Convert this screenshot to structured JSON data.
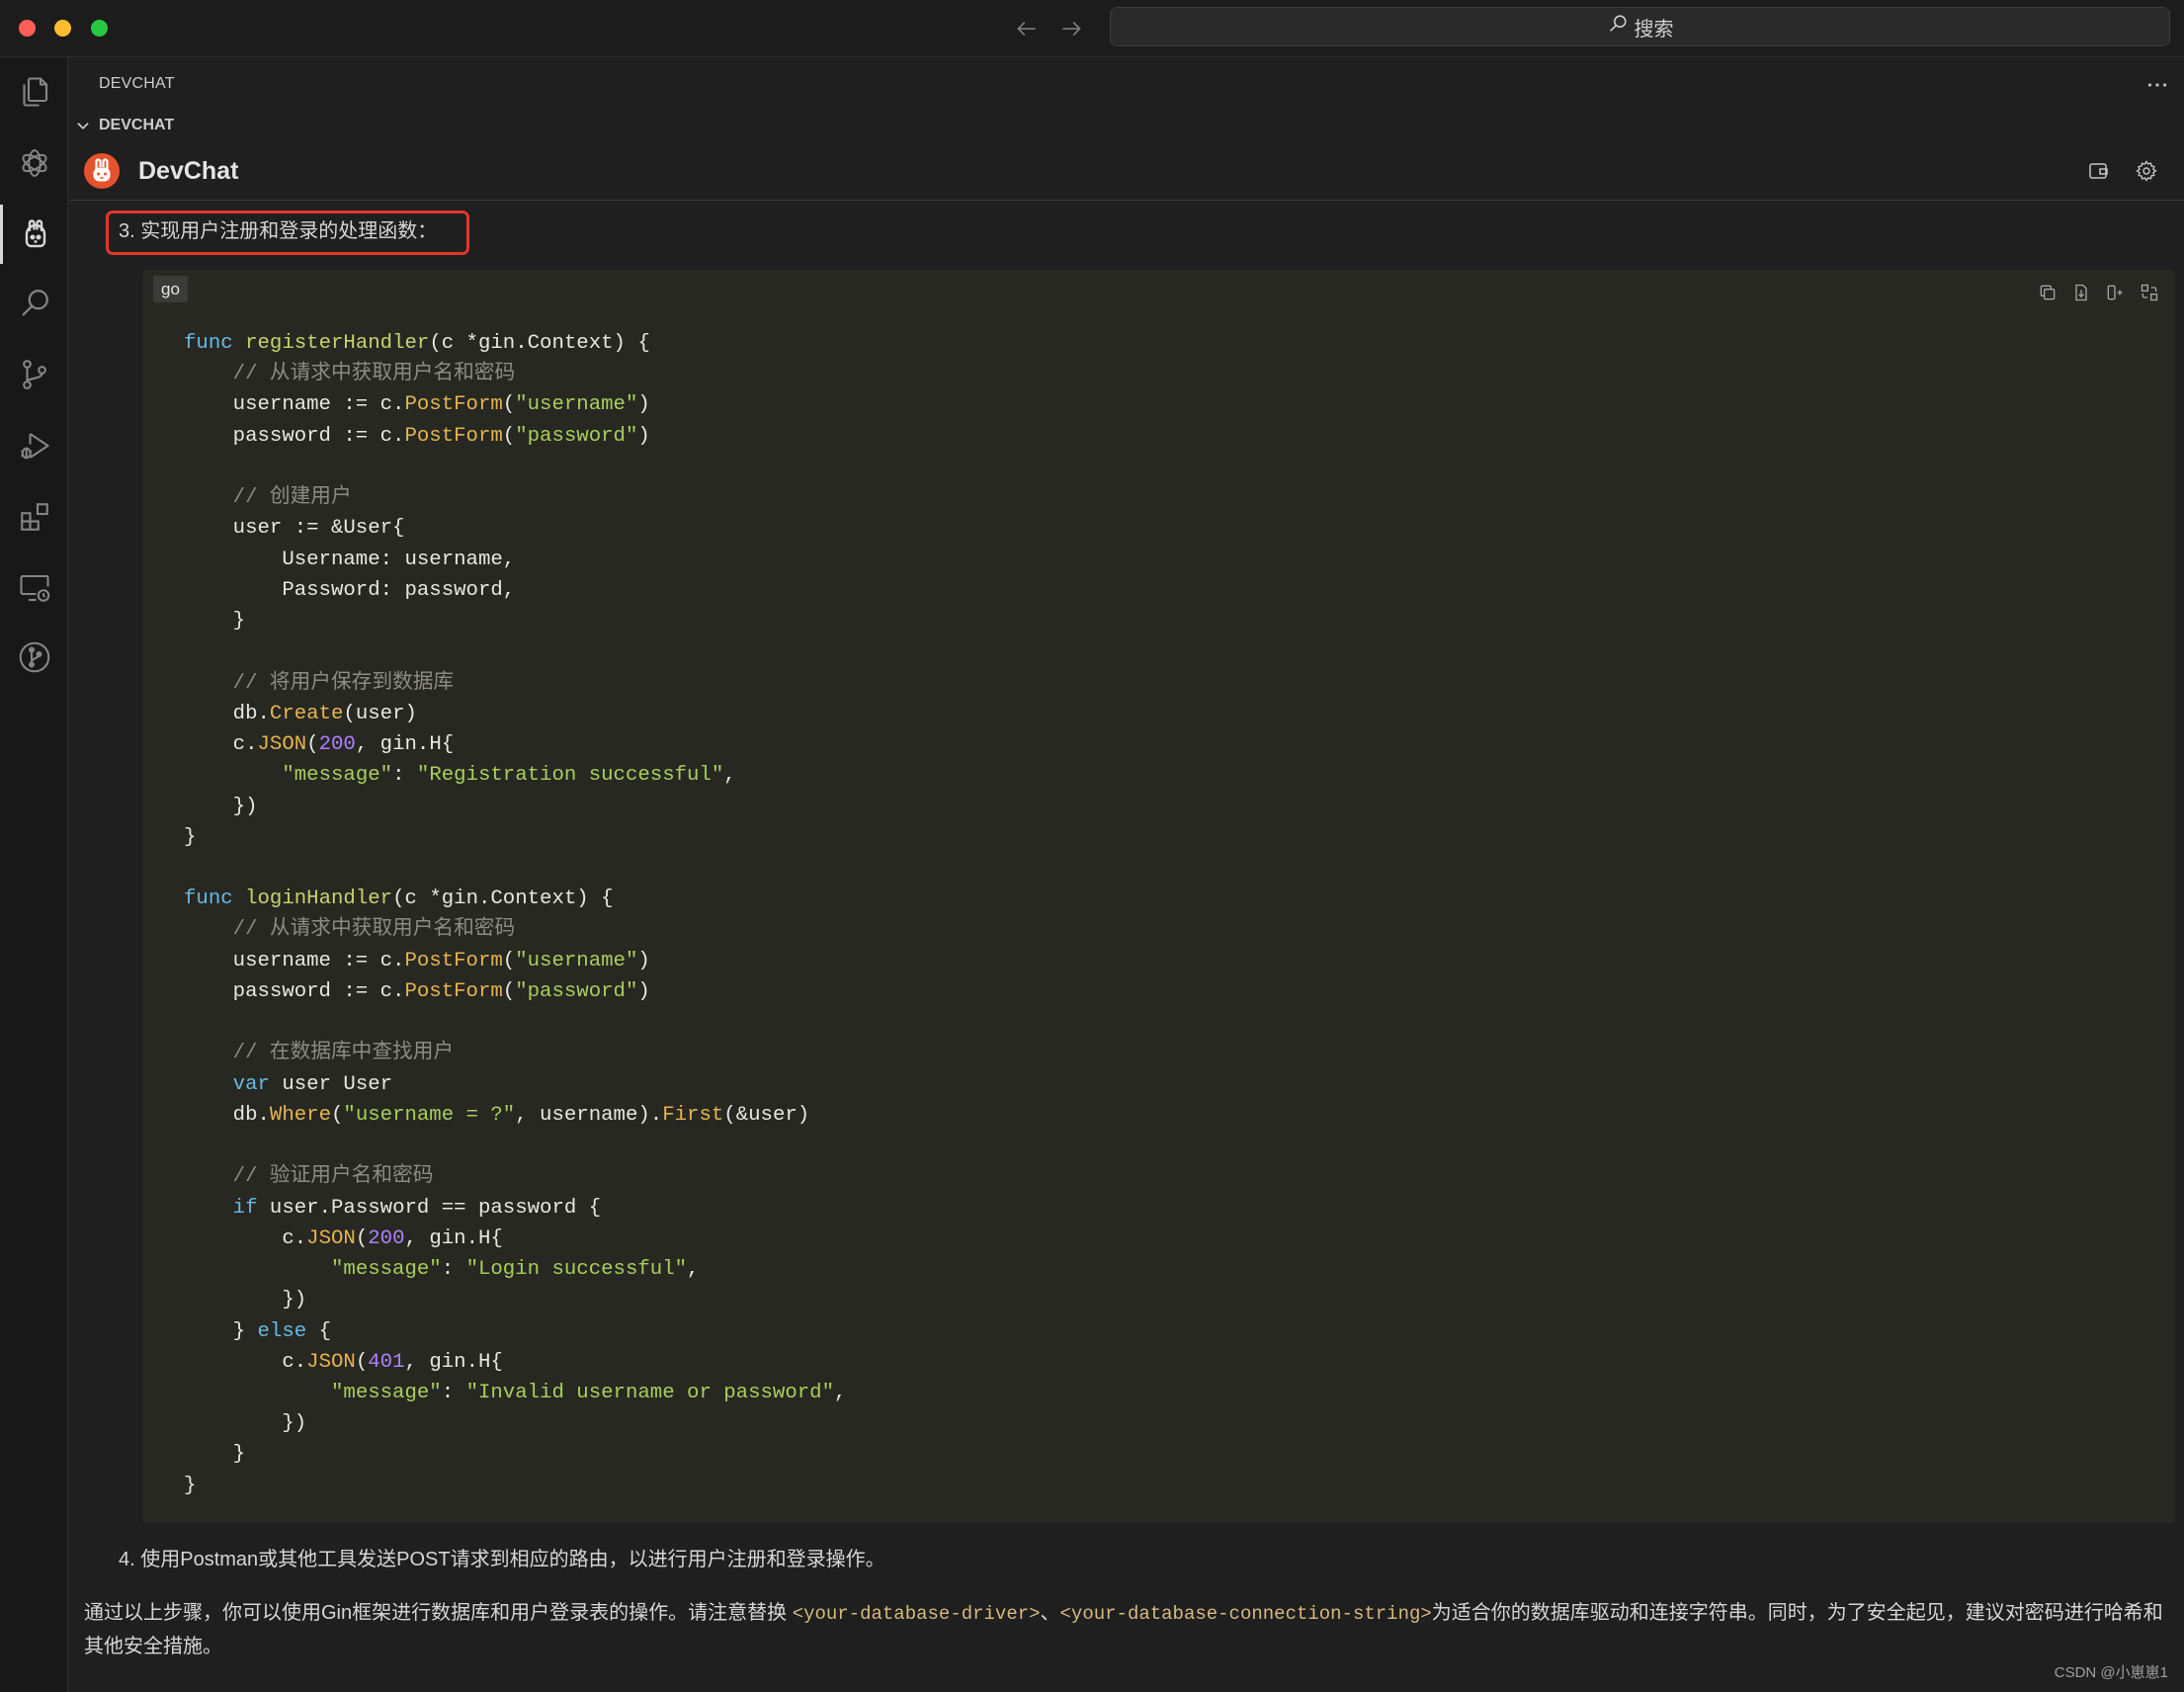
{
  "window": {
    "traffic_lights": {
      "close": "#ff5f57",
      "minimize": "#febc2e",
      "zoom": "#28c840"
    },
    "nav": {
      "back_icon": "arrow-left-icon",
      "forward_icon": "arrow-right-icon"
    },
    "search": {
      "label": "搜索",
      "icon": "search-icon"
    }
  },
  "activity_bar": {
    "items": [
      {
        "icon": "files-icon",
        "active": false
      },
      {
        "icon": "openai-icon",
        "active": false
      },
      {
        "icon": "devchat-rabbit-icon",
        "active": true
      },
      {
        "icon": "search-icon",
        "active": false
      },
      {
        "icon": "source-control-icon",
        "active": false
      },
      {
        "icon": "run-debug-icon",
        "active": false
      },
      {
        "icon": "extensions-icon",
        "active": false
      },
      {
        "icon": "remote-explorer-icon",
        "active": false
      },
      {
        "icon": "git-graph-icon",
        "active": false
      }
    ]
  },
  "panel": {
    "title": "DEVCHAT",
    "more_icon": "ellipsis-icon",
    "section": {
      "title": "DEVCHAT",
      "expanded": true
    },
    "header": {
      "name": "DevChat",
      "logo": "devchat-logo",
      "actions": [
        "new-chat-icon",
        "settings-icon"
      ]
    }
  },
  "chat": {
    "step3": "3. 实现用户注册和登录的处理函数：",
    "highlight_color": "#e0372c",
    "code_block": {
      "language": "go",
      "background": "#272822",
      "actions": [
        "copy-icon",
        "insert-file-icon",
        "insert-code-icon",
        "diff-icon"
      ],
      "lines": [
        [
          {
            "text": "func",
            "color": "#66b9e4"
          },
          " ",
          {
            "text": "registerHandler",
            "color": "#c6d36c"
          },
          "(c *gin.Context) {"
        ],
        [
          "    ",
          {
            "text": "// 从请求中获取用户名和密码",
            "color": "#8c8c84"
          }
        ],
        [
          "    username := c.",
          {
            "text": "PostForm",
            "color": "#e6b450"
          },
          "(",
          {
            "text": "\"username\"",
            "color": "#a8cf5a"
          },
          ")"
        ],
        [
          "    password := c.",
          {
            "text": "PostForm",
            "color": "#e6b450"
          },
          "(",
          {
            "text": "\"password\"",
            "color": "#a8cf5a"
          },
          ")"
        ],
        [],
        [
          "    ",
          {
            "text": "// 创建用户",
            "color": "#8c8c84"
          }
        ],
        [
          "    user := &User{"
        ],
        [
          "        Username: username,"
        ],
        [
          "        Password: password,"
        ],
        [
          "    }"
        ],
        [],
        [
          "    ",
          {
            "text": "// 将用户保存到数据库",
            "color": "#8c8c84"
          }
        ],
        [
          "    db.",
          {
            "text": "Create",
            "color": "#e6b450"
          },
          "(user)"
        ],
        [
          "    c.",
          {
            "text": "JSON",
            "color": "#e6b450"
          },
          "(",
          {
            "text": "200",
            "color": "#ae81ff"
          },
          ", gin.H{"
        ],
        [
          "        ",
          {
            "text": "\"message\"",
            "color": "#a8cf5a"
          },
          ": ",
          {
            "text": "\"Registration successful\"",
            "color": "#a8cf5a"
          },
          ","
        ],
        [
          "    })"
        ],
        [
          "}"
        ],
        [],
        [
          {
            "text": "func",
            "color": "#66b9e4"
          },
          " ",
          {
            "text": "loginHandler",
            "color": "#c6d36c"
          },
          "(c *gin.Context) {"
        ],
        [
          "    ",
          {
            "text": "// 从请求中获取用户名和密码",
            "color": "#8c8c84"
          }
        ],
        [
          "    username := c.",
          {
            "text": "PostForm",
            "color": "#e6b450"
          },
          "(",
          {
            "text": "\"username\"",
            "color": "#a8cf5a"
          },
          ")"
        ],
        [
          "    password := c.",
          {
            "text": "PostForm",
            "color": "#e6b450"
          },
          "(",
          {
            "text": "\"password\"",
            "color": "#a8cf5a"
          },
          ")"
        ],
        [],
        [
          "    ",
          {
            "text": "// 在数据库中查找用户",
            "color": "#8c8c84"
          }
        ],
        [
          "    ",
          {
            "text": "var",
            "color": "#66b9e4"
          },
          " user User"
        ],
        [
          "    db.",
          {
            "text": "Where",
            "color": "#e6b450"
          },
          "(",
          {
            "text": "\"username = ?\"",
            "color": "#a8cf5a"
          },
          ", username).",
          {
            "text": "First",
            "color": "#e6b450"
          },
          "(&user)"
        ],
        [],
        [
          "    ",
          {
            "text": "// 验证用户名和密码",
            "color": "#8c8c84"
          }
        ],
        [
          "    ",
          {
            "text": "if",
            "color": "#66b9e4"
          },
          " user.Password == password {"
        ],
        [
          "        c.",
          {
            "text": "JSON",
            "color": "#e6b450"
          },
          "(",
          {
            "text": "200",
            "color": "#ae81ff"
          },
          ", gin.H{"
        ],
        [
          "            ",
          {
            "text": "\"message\"",
            "color": "#a8cf5a"
          },
          ": ",
          {
            "text": "\"Login successful\"",
            "color": "#a8cf5a"
          },
          ","
        ],
        [
          "        })"
        ],
        [
          "    } ",
          {
            "text": "else",
            "color": "#66b9e4"
          },
          " {"
        ],
        [
          "        c.",
          {
            "text": "JSON",
            "color": "#e6b450"
          },
          "(",
          {
            "text": "401",
            "color": "#ae81ff"
          },
          ", gin.H{"
        ],
        [
          "            ",
          {
            "text": "\"message\"",
            "color": "#a8cf5a"
          },
          ": ",
          {
            "text": "\"Invalid username or password\"",
            "color": "#a8cf5a"
          },
          ","
        ],
        [
          "        })"
        ],
        [
          "    }"
        ],
        [
          "}"
        ]
      ]
    },
    "step4": "4. 使用Postman或其他工具发送POST请求到相应的路由，以进行用户注册和登录操作。",
    "summary": [
      {
        "text": "通过以上步骤，你可以使用Gin框架进行数据库和用户登录表的操作。请注意替换 "
      },
      {
        "code": "<your-database-driver>"
      },
      {
        "text": "、"
      },
      {
        "code": "<your-database-connection-string>"
      },
      {
        "text": "为适合你的数据库驱动和连接字符串。同时，为了安全起见，建议对密码进行哈希和其他安全措施。"
      }
    ]
  },
  "watermark": "CSDN @小崽崽1"
}
